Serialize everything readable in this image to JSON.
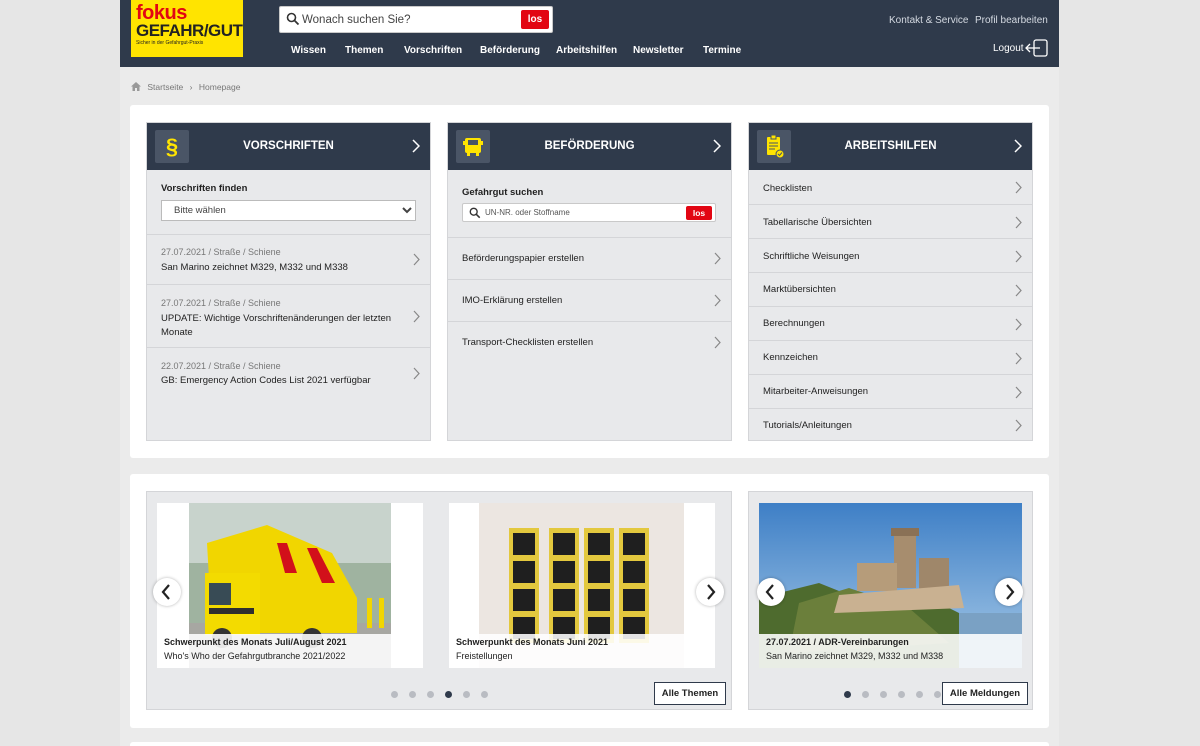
{
  "logo": {
    "line1": "fokus",
    "line2": "GEFAHR/GUT",
    "tagline": "Sicher in der Gefahrgut-Praxis"
  },
  "search": {
    "placeholder": "Wonach suchen Sie?",
    "button": "los"
  },
  "toplinks": {
    "contact": "Kontakt & Service",
    "profile": "Profil bearbeiten"
  },
  "nav": {
    "items": [
      "Wissen",
      "Themen",
      "Vorschriften",
      "Beförderung",
      "Arbeitshilfen",
      "Newsletter",
      "Termine"
    ],
    "logout": "Logout"
  },
  "breadcrumb": {
    "home": "Startseite",
    "sep": "›",
    "current": "Homepage"
  },
  "vorschriften": {
    "title": "VORSCHRIFTEN",
    "find_label": "Vorschriften finden",
    "select_value": "Bitte wählen",
    "news": [
      {
        "meta": "27.07.2021 / Straße / Schiene",
        "title": "San Marino zeichnet M329, M332 und M338"
      },
      {
        "meta": "27.07.2021 / Straße / Schiene",
        "title": "UPDATE: Wichtige Vorschriftenänderungen der letzten Monate"
      },
      {
        "meta": "22.07.2021 / Straße / Schiene",
        "title": "GB: Emergency Action Codes List 2021 verfügbar"
      }
    ]
  },
  "befoerderung": {
    "title": "BEFÖRDERUNG",
    "search_label": "Gefahrgut suchen",
    "search_placeholder": "UN-NR. oder Stoffname",
    "search_button": "los",
    "items": [
      "Beförderungspapier erstellen",
      "IMO-Erklärung erstellen",
      "Transport-Checklisten erstellen"
    ]
  },
  "arbeitshilfen": {
    "title": "ARBEITSHILFEN",
    "items": [
      "Checklisten",
      "Tabellarische Übersichten",
      "Schriftliche Weisungen",
      "Marktübersichten",
      "Berechnungen",
      "Kennzeichen",
      "Mitarbeiter-Anweisungen",
      "Tutorials/Anleitungen"
    ]
  },
  "themen_slider": {
    "slides": [
      {
        "title": "Schwerpunkt des Monats Juli/August 2021",
        "subtitle": "Who's Who der Gefahrgutbranche 2021/2022"
      },
      {
        "title": "Schwerpunkt des Monats Juni 2021",
        "subtitle": "Freistellungen"
      }
    ],
    "dot_count": 6,
    "active_dot": 4,
    "button": "Alle Themen"
  },
  "meldungen_slider": {
    "slide": {
      "title": "27.07.2021 / ADR-Vereinbarungen",
      "subtitle": "San Marino zeichnet M329, M332 und M338"
    },
    "dot_count": 6,
    "active_dot": 1,
    "button": "Alle Meldungen"
  },
  "colors": {
    "header": "#2f3a4b",
    "accent": "#e20613",
    "logo": "#ffe400"
  }
}
